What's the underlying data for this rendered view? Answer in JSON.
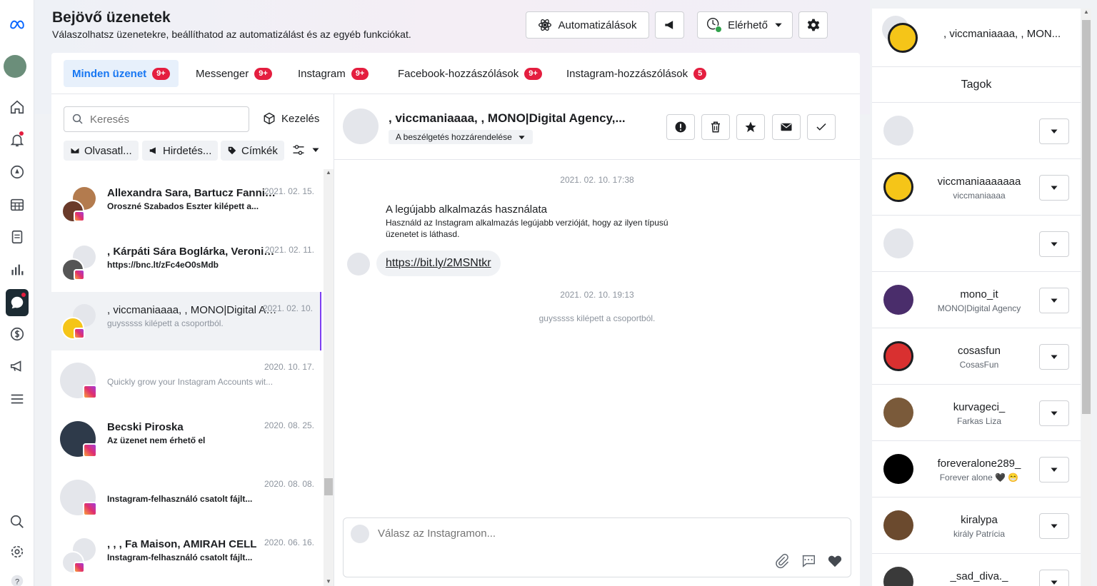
{
  "header": {
    "title": "Bejövő üzenetek",
    "subtitle": "Válaszolhatsz üzenetekre, beállíthatod az automatizálást és az egyéb funkciókat.",
    "automations_label": "Automatizálások",
    "status_label": "Elérhető"
  },
  "tabs": [
    {
      "label": "Minden üzenet",
      "badge": "9+"
    },
    {
      "label": "Messenger",
      "badge": "9+"
    },
    {
      "label": "Instagram",
      "badge": "9+"
    },
    {
      "label": "Facebook-hozzászólások",
      "badge": "9+"
    },
    {
      "label": "Instagram-hozzászólások",
      "badge": "5"
    }
  ],
  "list": {
    "search_placeholder": "Keresés",
    "manage_label": "Kezelés",
    "filters": [
      "Olvasatl...",
      "Hirdetés...",
      "Címkék"
    ],
    "conversations": [
      {
        "name": "Allexandra Sara, Bartucz Fanni, H...",
        "snippet": "Oroszné Szabados Eszter kilépett a...",
        "date": "2021. 02. 15."
      },
      {
        "name": ", Kárpáti Sára Boglárka, Veronika ...",
        "snippet": "https://bnc.lt/zFc4eO0sMdb",
        "date": "2021. 02. 11."
      },
      {
        "name": ", viccmaniaaaa, , MONO|Digital Age...",
        "snippet": "guysssss kilépett a csoportból.",
        "date": "2021. 02. 10."
      },
      {
        "name": "",
        "snippet": "Quickly grow your Instagram Accounts wit...",
        "date": "2020. 10. 17."
      },
      {
        "name": "Becski Piroska",
        "snippet": "Az üzenet nem érhető el",
        "date": "2020. 08. 25."
      },
      {
        "name": "",
        "snippet": "Instagram-felhasználó csatolt fájlt...",
        "date": "2020. 08. 08."
      },
      {
        "name": ", , , Fa Maison, AMIRAH CELL",
        "snippet": "Instagram-felhasználó csatolt fájlt...",
        "date": "2020. 06. 16."
      }
    ]
  },
  "chat": {
    "title": ", viccmaniaaaa, , MONO|Digital Agency,...",
    "assign_label": "A beszélgetés hozzárendelése",
    "timestamp1": "2021. 02. 10. 17:38",
    "system_title": "A legújabb alkalmazás használata",
    "system_body": "Használd az Instagram alkalmazás legújabb verzióját, hogy az ilyen típusú üzenetet is láthasd.",
    "link": "https://bit.ly/2MSNtkr",
    "timestamp2": "2021. 02. 10. 19:13",
    "left_notice": "guysssss kilépett a csoportból.",
    "reply_placeholder": "Válasz az Instagramon..."
  },
  "members": {
    "header_name": ", viccmaniaaaa, , MON...",
    "title": "Tagok",
    "list": [
      {
        "username": "",
        "name": ""
      },
      {
        "username": "viccmaniaaaaaaa",
        "name": "viccmaniaaaa"
      },
      {
        "username": "",
        "name": ""
      },
      {
        "username": "mono_it",
        "name": "MONO|Digital Agency"
      },
      {
        "username": "cosasfun",
        "name": "CosasFun"
      },
      {
        "username": "kurvageci_",
        "name": "Farkas Liza"
      },
      {
        "username": "foreveralone289_",
        "name": "Forever alone 🖤 😁"
      },
      {
        "username": "kiralypa",
        "name": "király Patrícia"
      },
      {
        "username": "_sad_diva._",
        "name": ""
      }
    ]
  },
  "colors": {
    "accent": "#1877f2",
    "badge": "#e41e3f",
    "selected_border": "#7e3ff2",
    "online": "#31a24c"
  }
}
